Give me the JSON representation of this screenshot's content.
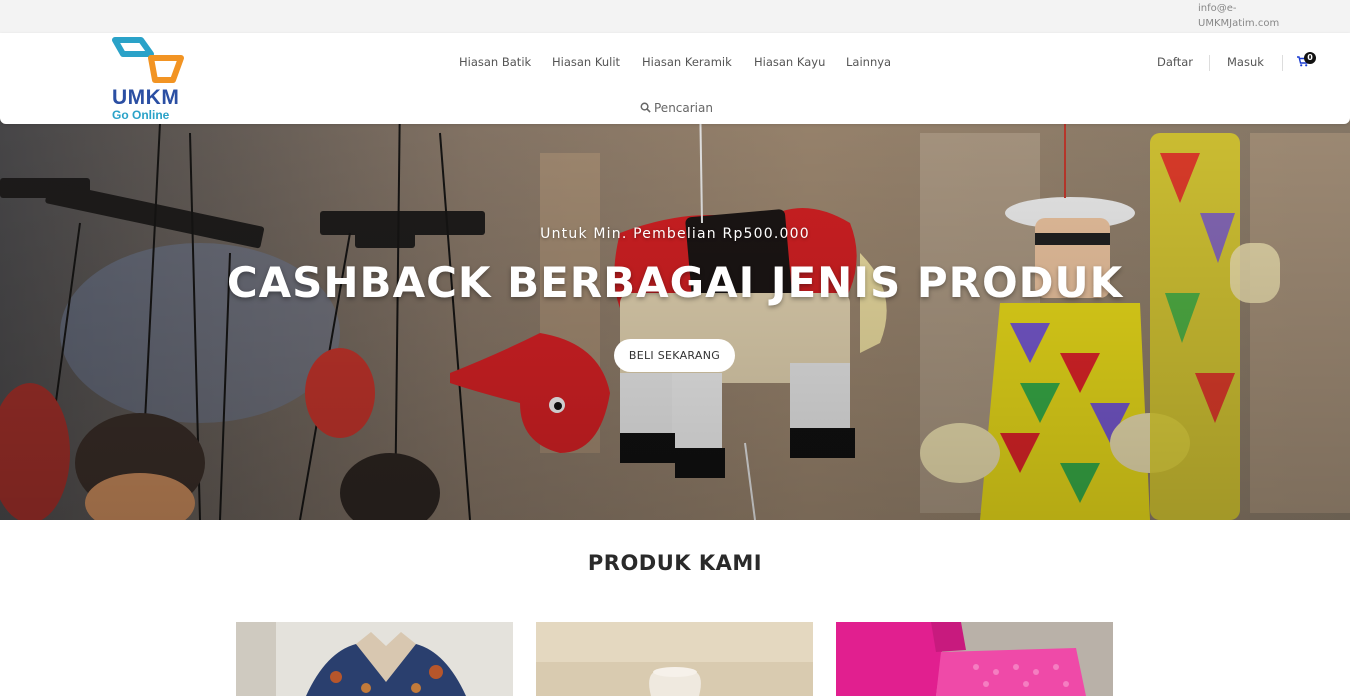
{
  "topbar": {
    "email": "info@e-UMKMJatim.com"
  },
  "logo": {
    "line1": "UMKM",
    "line2": "Go Online",
    "colors": {
      "teal": "#2aa2c8",
      "orange": "#f29423",
      "blue": "#2b4fa3"
    }
  },
  "nav": {
    "items": [
      {
        "label": "Hiasan Batik"
      },
      {
        "label": "Hiasan Kulit"
      },
      {
        "label": "Hiasan Keramik"
      },
      {
        "label": "Hiasan Kayu"
      },
      {
        "label": "Lainnya"
      }
    ],
    "search_label": "Pencarian"
  },
  "account": {
    "register_label": "Daftar",
    "login_label": "Masuk",
    "cart_count": "0"
  },
  "hero": {
    "subtitle": "Untuk Min. Pembelian Rp500.000",
    "title": "CASHBACK BERBAGAI JENIS PRODUK",
    "button_label": "BELI SEKARANG",
    "image": "wooden-puppets-photo"
  },
  "products": {
    "section_title": "PRODUK KAMI",
    "cards": [
      {
        "image": "batik-shirt-photo"
      },
      {
        "image": "ceramic-vase-photo"
      },
      {
        "image": "pink-fabric-photo"
      }
    ]
  },
  "colors": {
    "accent": "#1a3cd1",
    "hero_overlay": "#000000"
  }
}
